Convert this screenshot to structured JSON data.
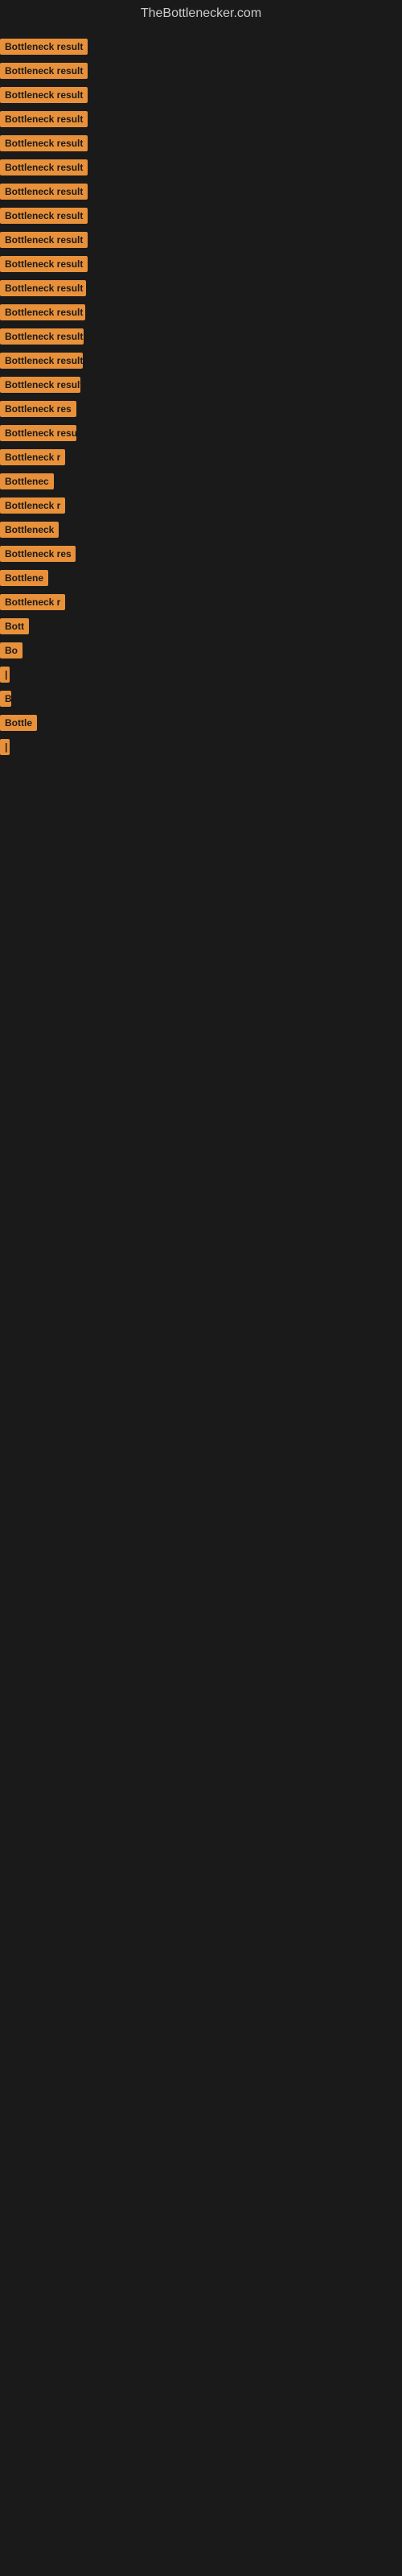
{
  "site": {
    "title": "TheBottlenecker.com"
  },
  "items": [
    {
      "label": "Bottleneck result",
      "width": 120
    },
    {
      "label": "Bottleneck result",
      "width": 120
    },
    {
      "label": "Bottleneck result",
      "width": 118
    },
    {
      "label": "Bottleneck result",
      "width": 118
    },
    {
      "label": "Bottleneck result",
      "width": 116
    },
    {
      "label": "Bottleneck result",
      "width": 115
    },
    {
      "label": "Bottleneck result",
      "width": 113
    },
    {
      "label": "Bottleneck result",
      "width": 112
    },
    {
      "label": "Bottleneck result",
      "width": 110
    },
    {
      "label": "Bottleneck result",
      "width": 109
    },
    {
      "label": "Bottleneck result",
      "width": 107
    },
    {
      "label": "Bottleneck result",
      "width": 106
    },
    {
      "label": "Bottleneck result",
      "width": 104
    },
    {
      "label": "Bottleneck result",
      "width": 103
    },
    {
      "label": "Bottleneck result",
      "width": 100
    },
    {
      "label": "Bottleneck res",
      "width": 97
    },
    {
      "label": "Bottleneck result",
      "width": 95
    },
    {
      "label": "Bottleneck r",
      "width": 90
    },
    {
      "label": "Bottlenec",
      "width": 82
    },
    {
      "label": "Bottleneck r",
      "width": 88
    },
    {
      "label": "Bottleneck",
      "width": 80
    },
    {
      "label": "Bottleneck res",
      "width": 94
    },
    {
      "label": "Bottlene",
      "width": 74
    },
    {
      "label": "Bottleneck r",
      "width": 86
    },
    {
      "label": "Bott",
      "width": 40
    },
    {
      "label": "Bo",
      "width": 28
    },
    {
      "label": "|",
      "width": 8
    },
    {
      "label": "B",
      "width": 14
    },
    {
      "label": "Bottle",
      "width": 50
    },
    {
      "label": "|",
      "width": 8
    }
  ]
}
